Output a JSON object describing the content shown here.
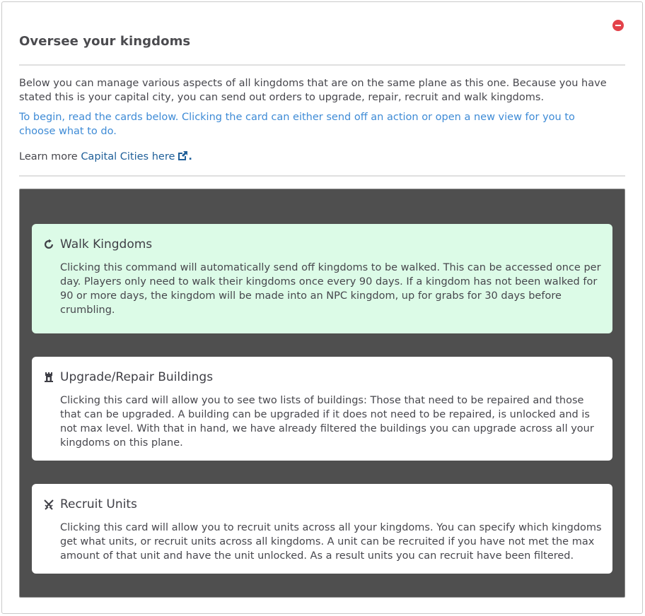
{
  "modal": {
    "title": "Oversee your kingdoms",
    "close_icon": "minus-circle-icon",
    "intro": "Below you can manage various aspects of all kingdoms that are on the same plane as this one. Because you have stated this is your capital city, you can send out orders to upgrade, repair, recruit and walk kingdoms.",
    "hint": "To begin, read the cards below. Clicking the card can either send off an action or open a new view for you to choose what to do.",
    "learn_prefix": "Learn more ",
    "learn_link": "Capital Cities here",
    "learn_suffix": "."
  },
  "cards": [
    {
      "icon": "refresh-icon",
      "title": "Walk Kingdoms",
      "body": "Clicking this command will automatically send off kingdoms to be walked. This can be accessed once per day. Players only need to walk their kingdoms once every 90 days. If a kingdom has not been walked for 90 or more days, the kingdom will be made into an NPC kingdom, up for grabs for 30 days before crumbling."
    },
    {
      "icon": "tower-icon",
      "title": "Upgrade/Repair Buildings",
      "body": "Clicking this card will allow you to see two lists of buildings: Those that need to be repaired and those that can be upgraded. A building can be upgraded if it does not need to be repaired, is unlocked and is not max level. With that in hand, we have already filtered the buildings you can upgrade across all your kingdoms on this plane."
    },
    {
      "icon": "crossed-swords-icon",
      "title": "Recruit Units",
      "body": "Clicking this card will allow you to recruit units across all your kingdoms. You can specify which kingdoms get what units, or recruit units across all kingdoms. A unit can be recruited if you have not met the max amount of that unit and have the unit unlocked. As a result units you can recruit have been filtered."
    }
  ],
  "colors": {
    "accent_link": "#1f5f99",
    "hint_text": "#3e8bd6",
    "panel_bg": "#4f4f4f",
    "active_card_bg": "#dcfbe7",
    "close_red": "#e3424a"
  }
}
